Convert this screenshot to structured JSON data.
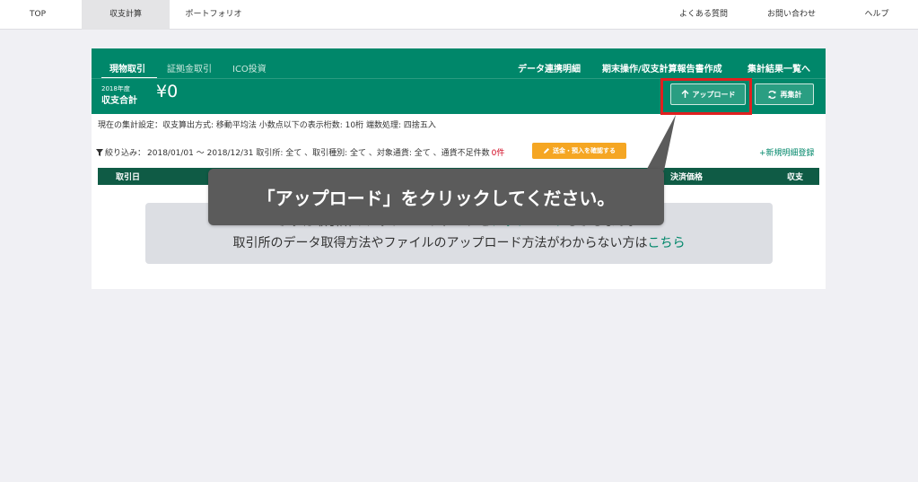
{
  "nav": {
    "top": "TOP",
    "calc": "収支計算",
    "portfolio": "ポートフォリオ",
    "faq": "よくある質問",
    "contact": "お問い合わせ",
    "help": "ヘルプ"
  },
  "card": {
    "tabs": [
      "現物取引",
      "証拠金取引",
      "ICO投資"
    ],
    "links": [
      "データ連携明細",
      "期末操作/収支計算報告書作成",
      "集計結果一覧へ"
    ],
    "year": "2018年度",
    "total_label": "収支合計",
    "total_value": "¥0",
    "upload_label": "アップロード",
    "recalc_label": "再集計"
  },
  "settings": "現在の集計設定：収支算出方式: 移動平均法  小数点以下の表示桁数: 10桁  端数処理: 四捨五入",
  "filter": {
    "prefix": "絞り込み：",
    "text": "2018/01/01 〜 2018/12/31 取引所: 全て 、取引種別: 全て 、対象通貨: 全て 、通貨不足件数",
    "missing_count": "0件",
    "confirm_label": "送金・預入を確認する",
    "new_entry": "新規明細登録"
  },
  "table": {
    "col_date": "取引日",
    "col_price": "決済価格",
    "col_pl": "収支"
  },
  "empty": {
    "line1_a": "まずは取引所のアップロードデータを",
    "line1_link": "アップロード",
    "line1_b": "しましょう。",
    "line2": "取引所のデータ取得方法やファイルのアップロード方法がわからない方は",
    "line2_link": "こちら"
  },
  "tooltip": "「アップロード」をクリックしてください。",
  "colors": {
    "brand": "#00876a",
    "table_header": "#0f5b45",
    "warning": "#f5a623",
    "highlight": "#e0201f"
  }
}
